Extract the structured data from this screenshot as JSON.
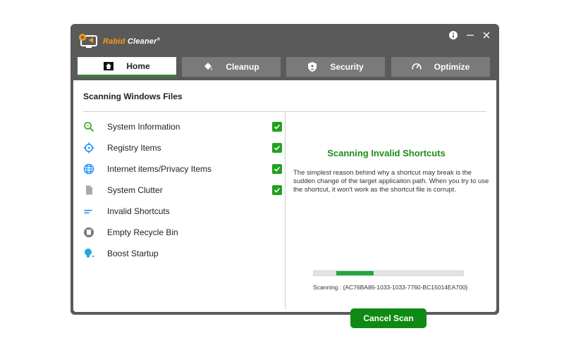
{
  "app": {
    "title_part1": "Rabid",
    "title_part2": "Cleaner",
    "trademark": "®"
  },
  "titlebar": {
    "info_icon": "info-icon",
    "minimize_icon": "minimize-icon",
    "close_icon": "close-icon"
  },
  "tabs": [
    {
      "label": "Home",
      "icon": "home-icon",
      "active": true
    },
    {
      "label": "Cleanup",
      "icon": "paint-bucket-icon",
      "active": false
    },
    {
      "label": "Security",
      "icon": "shield-icon",
      "active": false
    },
    {
      "label": "Optimize",
      "icon": "speedometer-icon",
      "active": false
    }
  ],
  "scan": {
    "section_title": "Scanning Windows Files",
    "items": [
      {
        "label": "System Information",
        "icon": "magnifier-icon",
        "checked": true
      },
      {
        "label": "Registry Items",
        "icon": "crosshair-icon",
        "checked": true
      },
      {
        "label": "Internet items/Privacy Items",
        "icon": "globe-icon",
        "checked": true
      },
      {
        "label": "System Clutter",
        "icon": "file-icon",
        "checked": true
      },
      {
        "label": "Invalid Shortcuts",
        "icon": "lines-icon",
        "checked": false
      },
      {
        "label": "Empty Recycle Bin",
        "icon": "trash-icon",
        "checked": false
      },
      {
        "label": "Boost Startup",
        "icon": "lightbulb-icon",
        "checked": false
      }
    ]
  },
  "detail": {
    "title": "Scanning Invalid Shortcuts",
    "description": "The simplest reason behind why a shortcut may break is the sudden change of the target applicaiton path. When you try to use the shortcut, it won't work as the shortcut file is corrupt.",
    "progress_start": 0.15,
    "progress_end": 0.4,
    "scanning_text": "Scanning  : {AC76BA86-1033-1033-7760-BC15014EA700}",
    "cancel_label": "Cancel Scan"
  },
  "colors": {
    "accent_green": "#1e8b1e",
    "button_green": "#0f8a14",
    "window_gray": "#5a5a5a",
    "tab_gray": "#7a7a7a",
    "logo_orange": "#f39c12"
  }
}
